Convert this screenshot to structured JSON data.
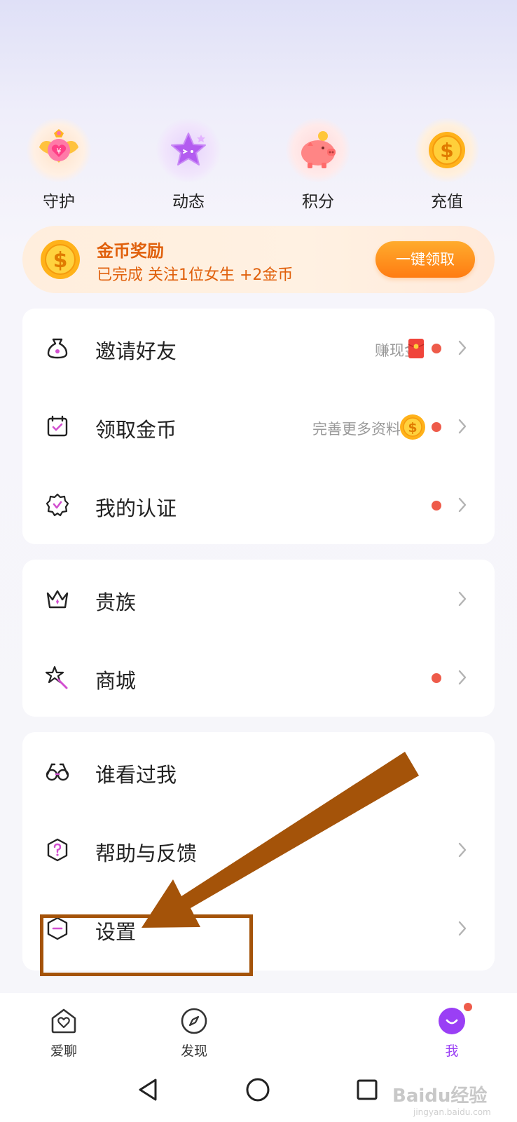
{
  "shortcuts": [
    {
      "label": "守护",
      "icon": "guard-heart-icon"
    },
    {
      "label": "动态",
      "icon": "star-face-icon"
    },
    {
      "label": "积分",
      "icon": "piggy-bank-icon"
    },
    {
      "label": "充值",
      "icon": "coin-icon"
    }
  ],
  "reward": {
    "title": "金币奖励",
    "desc": "已完成 关注1位女生 +2金币",
    "button": "一键领取"
  },
  "card1": [
    {
      "label": "邀请好友",
      "hint": "赚现金",
      "icon": "money-bag-icon",
      "hint_icon": "red-envelope-icon",
      "dot": true
    },
    {
      "label": "领取金币",
      "hint": "完善更多资料",
      "icon": "calendar-check-icon",
      "hint_icon": "coin-icon",
      "dot": true
    },
    {
      "label": "我的认证",
      "hint": "",
      "icon": "badge-check-icon",
      "dot": true
    }
  ],
  "card2": [
    {
      "label": "贵族",
      "icon": "crown-icon",
      "dot": false
    },
    {
      "label": "商城",
      "icon": "magic-wand-icon",
      "dot": true
    }
  ],
  "card3": [
    {
      "label": "谁看过我",
      "icon": "binoculars-icon",
      "dot": false
    },
    {
      "label": "帮助与反馈",
      "icon": "question-icon",
      "dot": false
    },
    {
      "label": "设置",
      "icon": "settings-hexagon-icon",
      "dot": false
    }
  ],
  "tabs": [
    {
      "label": "爱聊",
      "icon": "home-heart-icon"
    },
    {
      "label": "发现",
      "icon": "compass-icon"
    },
    {
      "label": "我",
      "icon": "profile-face-icon"
    }
  ],
  "watermark": {
    "text": "Baidu经验",
    "sub": "jingyan.baidu.com"
  },
  "colors": {
    "accent_orange": "#e0600c",
    "button_orange": "#ff8a18",
    "active_purple": "#9a3ff5",
    "dot_red": "#ee5b4a",
    "annotation_brown": "#a45309"
  }
}
